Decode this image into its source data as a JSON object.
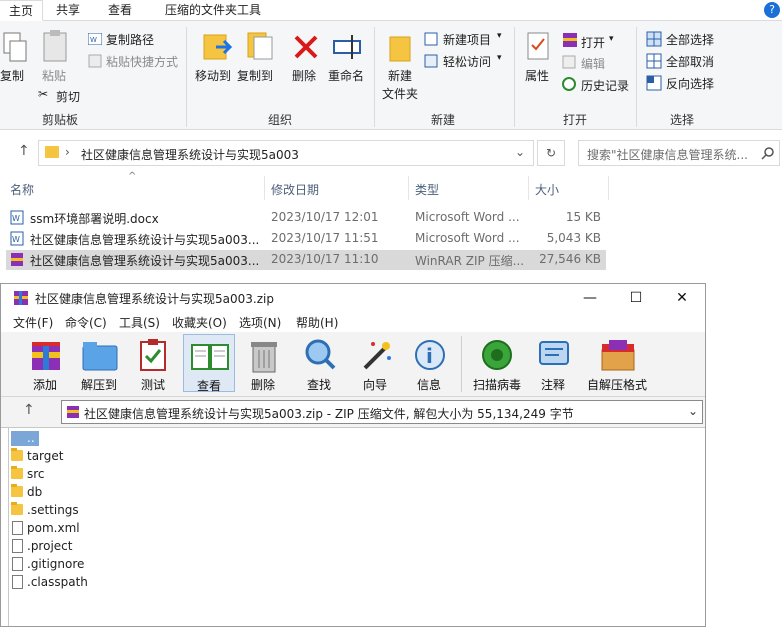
{
  "explorer": {
    "tabs": [
      "主页",
      "共享",
      "查看",
      "压缩的文件夹工具"
    ],
    "ribbon": {
      "clipboard": {
        "copy": "复制",
        "paste": "粘贴",
        "copy_path": "复制路径",
        "paste_shortcut": "粘贴快捷方式",
        "cut": "剪切",
        "group": "剪贴板"
      },
      "organize": {
        "move_to": "移动到",
        "copy_to": "复制到",
        "delete": "删除",
        "rename": "重命名",
        "group": "组织"
      },
      "new": {
        "new_folder": "新建\n文件夹",
        "new_folder_l1": "新建",
        "new_folder_l2": "文件夹",
        "new_item": "新建项目",
        "easy_access": "轻松访问",
        "group": "新建"
      },
      "open": {
        "properties": "属性",
        "open": "打开",
        "edit": "编辑",
        "history": "历史记录",
        "group": "打开"
      },
      "select": {
        "select_all": "全部选择",
        "select_none": "全部取消",
        "invert": "反向选择",
        "group": "选择"
      }
    },
    "address": {
      "path": "社区健康信息管理系统设计与实现5a003",
      "search_placeholder": "搜索\"社区健康信息管理系统..."
    },
    "columns": {
      "name": "名称",
      "modified": "修改日期",
      "type": "类型",
      "size": "大小"
    },
    "files": [
      {
        "name": "ssm环境部署说明.docx",
        "modified": "2023/10/17 12:01",
        "type": "Microsoft Word ...",
        "size": "15 KB",
        "selected": false
      },
      {
        "name": "社区健康信息管理系统设计与实现5a003...",
        "modified": "2023/10/17 11:51",
        "type": "Microsoft Word ...",
        "size": "5,043 KB",
        "selected": false
      },
      {
        "name": "社区健康信息管理系统设计与实现5a003...",
        "modified": "2023/10/17 11:10",
        "type": "WinRAR ZIP 压缩...",
        "size": "27,546 KB",
        "selected": true
      }
    ]
  },
  "winrar": {
    "title": "社区健康信息管理系统设计与实现5a003.zip",
    "menu": [
      "文件(F)",
      "命令(C)",
      "工具(S)",
      "收藏夹(O)",
      "选项(N)",
      "帮助(H)"
    ],
    "toolbar": [
      "添加",
      "解压到",
      "测试",
      "查看",
      "删除",
      "查找",
      "向导",
      "信息",
      "扫描病毒",
      "注释",
      "自解压格式"
    ],
    "path_text": "社区健康信息管理系统设计与实现5a003.zip - ZIP 压缩文件, 解包大小为 55,134,249 字节",
    "items": [
      {
        "name": "..",
        "kind": "up"
      },
      {
        "name": "target",
        "kind": "folder"
      },
      {
        "name": "src",
        "kind": "folder"
      },
      {
        "name": "db",
        "kind": "folder"
      },
      {
        "name": ".settings",
        "kind": "folder"
      },
      {
        "name": "pom.xml",
        "kind": "file"
      },
      {
        "name": ".project",
        "kind": "file"
      },
      {
        "name": ".gitignore",
        "kind": "file"
      },
      {
        "name": ".classpath",
        "kind": "file"
      }
    ]
  },
  "colors": {
    "accent": "#1a73e8",
    "selection": "#d9d9d9",
    "folder": "#f5c542",
    "help_badge": "#1b6fd6"
  }
}
